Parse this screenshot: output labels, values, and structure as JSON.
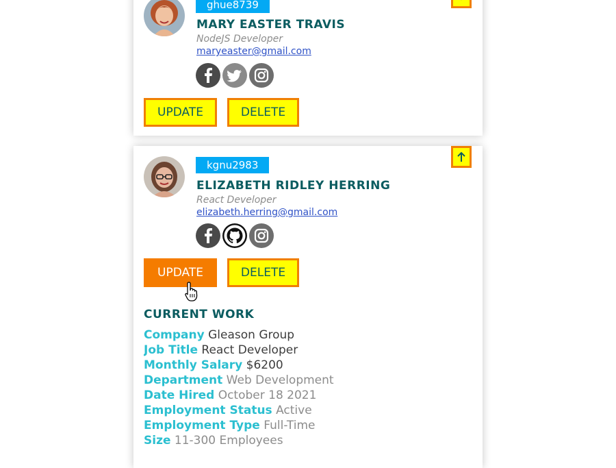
{
  "users": [
    {
      "id": "ghue8739",
      "name": "MARY EASTER TRAVIS",
      "role": "NodeJS Developer",
      "email": "maryeaster@gmail.com",
      "socials": [
        "facebook-icon",
        "twitter-icon",
        "instagram-icon"
      ],
      "update_label": "UPDATE",
      "delete_label": "DELETE",
      "toggle_icon": "chevron-down-icon"
    },
    {
      "id": "kgnu2983",
      "name": "ELIZABETH RIDLEY HERRING",
      "role": "React Developer",
      "email": "elizabeth.herring@gmail.com",
      "socials": [
        "facebook-icon",
        "github-icon",
        "instagram-icon"
      ],
      "update_label": "UPDATE",
      "delete_label": "DELETE",
      "toggle_icon": "arrow-up-icon",
      "current_work": {
        "title": "CURRENT WORK",
        "rows": [
          {
            "label": "Company",
            "value": "Gleason Group"
          },
          {
            "label": "Job Title",
            "value": "React Developer"
          },
          {
            "label": "Monthly Salary",
            "value": "$6200"
          },
          {
            "label": "Department",
            "value": "Web Development"
          },
          {
            "label": "Date Hired",
            "value": "October 18 2021"
          },
          {
            "label": "Employment Status",
            "value": "Active"
          },
          {
            "label": "Employment Type",
            "value": "Full-Time"
          },
          {
            "label": "Size",
            "value": "11-300 Employees"
          }
        ]
      }
    }
  ],
  "colors": {
    "accent_blue": "#03a9f4",
    "name_teal": "#0b5c60",
    "label_cyan": "#2bbfd0",
    "button_yellow": "#ffff00",
    "button_orange": "#f57c00"
  }
}
